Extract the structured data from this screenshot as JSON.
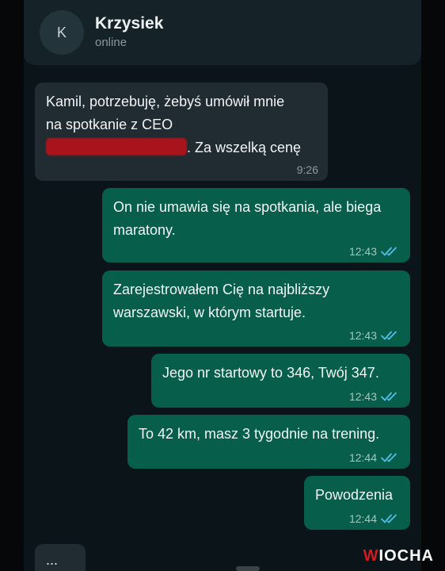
{
  "header": {
    "avatar_letter": "K",
    "contact_name": "Krzysiek",
    "status": "online"
  },
  "messages": [
    {
      "direction": "incoming",
      "line1": "Kamil, potrzebuję, żebyś umówił mnie",
      "line2": "na spotkanie z CEO",
      "line3_after_redaction": ". Za wszelką cenę",
      "redacted": true,
      "time": "9:26"
    },
    {
      "direction": "outgoing",
      "text": "On nie umawia się na spotkania, ale biega maratony.",
      "time": "12:43",
      "status": "read"
    },
    {
      "direction": "outgoing",
      "text": "Zarejestrowałem Cię na najbliższy warszawski, w którym startuje.",
      "time": "12:43",
      "status": "read"
    },
    {
      "direction": "outgoing",
      "text": "Jego nr startowy to 346, Twój 347.",
      "time": "12:43",
      "status": "read"
    },
    {
      "direction": "outgoing",
      "text": "To 42 km, masz 3 tygodnie na trening.",
      "time": "12:44",
      "status": "read"
    },
    {
      "direction": "outgoing",
      "text": "Powodzenia",
      "time": "12:44",
      "status": "read"
    }
  ],
  "typing_indicator": "...",
  "watermark": {
    "part1": "W",
    "part2": "IOCHA"
  },
  "colors": {
    "background": "#0b1418",
    "incoming_bubble": "#202c31",
    "outgoing_bubble": "#075e4a",
    "read_ticks": "#53bdeb",
    "redaction": "#a8141c"
  }
}
